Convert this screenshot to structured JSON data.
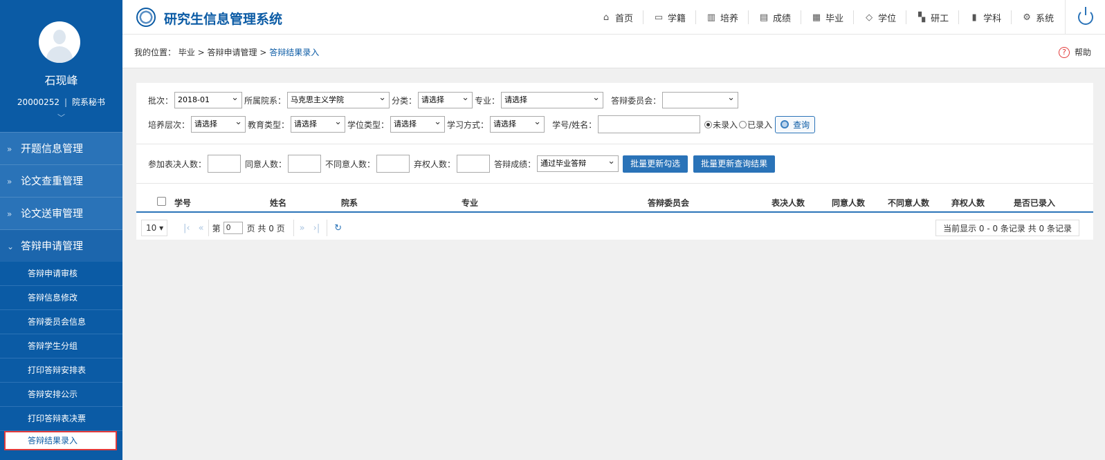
{
  "sidebar": {
    "user_name": "石现峰",
    "user_id": "20000252",
    "user_role": "院系秘书",
    "menu": [
      {
        "label": "开题信息管理"
      },
      {
        "label": "论文查重管理"
      },
      {
        "label": "论文送审管理"
      },
      {
        "label": "答辩申请管理"
      }
    ],
    "submenu": [
      {
        "label": "答辩申请审核"
      },
      {
        "label": "答辩信息修改"
      },
      {
        "label": "答辩委员会信息"
      },
      {
        "label": "答辩学生分组"
      },
      {
        "label": "打印答辩安排表"
      },
      {
        "label": "答辩安排公示"
      },
      {
        "label": "打印答辩表决票"
      },
      {
        "label": "答辩结果录入"
      }
    ]
  },
  "header": {
    "title": "研究生信息管理系统",
    "nav": [
      {
        "label": "首页",
        "icon": "⌂"
      },
      {
        "label": "学籍",
        "icon": "▭"
      },
      {
        "label": "培养",
        "icon": "▥"
      },
      {
        "label": "成绩",
        "icon": "▤"
      },
      {
        "label": "毕业",
        "icon": "▦"
      },
      {
        "label": "学位",
        "icon": "◇"
      },
      {
        "label": "研工",
        "icon": "▚"
      },
      {
        "label": "学科",
        "icon": "▮"
      },
      {
        "label": "系统",
        "icon": "⚙"
      }
    ]
  },
  "breadcrumb": {
    "prefix": "我的位置：",
    "path": "毕业 > 答辩申请管理 > ",
    "current": "答辩结果录入"
  },
  "help_label": "帮助",
  "filters": {
    "batch_label": "批次：",
    "batch_value": "2018-01",
    "dept_label": "所属院系：",
    "dept_value": "马克思主义学院",
    "category_label": "分类：",
    "category_value": "请选择",
    "major_label": "专业：",
    "major_value": "请选择",
    "committee_label": "答辩委员会：",
    "committee_value": "",
    "level_label": "培养层次：",
    "level_value": "请选择",
    "edu_type_label": "教育类型：",
    "edu_type_value": "请选择",
    "degree_type_label": "学位类型：",
    "degree_type_value": "请选择",
    "study_mode_label": "学习方式：",
    "study_mode_value": "请选择",
    "student_label": "学号/姓名：",
    "radio_not_entered": "未录入",
    "radio_entered": "已录入",
    "query_button": "查询"
  },
  "batch_form": {
    "voters_label": "参加表决人数：",
    "agree_label": "同意人数：",
    "disagree_label": "不同意人数：",
    "abstain_label": "弃权人数：",
    "result_label": "答辩成绩：",
    "result_value": "通过毕业答辩",
    "update_selected": "批量更新勾选",
    "update_query": "批量更新查询结果"
  },
  "table": {
    "columns": [
      "学号",
      "姓名",
      "院系",
      "专业",
      "答辩委员会",
      "表决人数",
      "同意人数",
      "不同意人数",
      "弃权人数",
      "是否已录入"
    ],
    "rows": []
  },
  "pager": {
    "page_size": "10 ▾",
    "page_prefix": "第",
    "page_value": "0",
    "page_suffix": "页 共 0 页",
    "summary": "当前显示 0 - 0 条记录 共 0 条记录"
  }
}
